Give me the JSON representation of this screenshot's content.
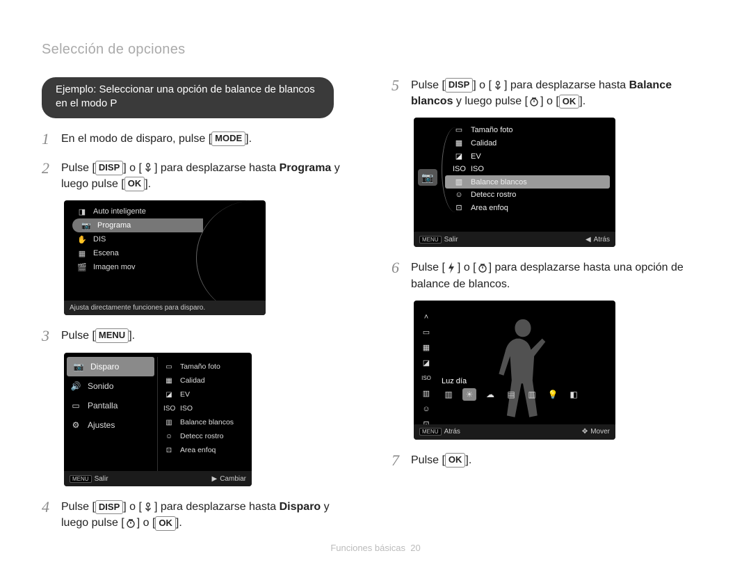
{
  "header": "Selección de opciones",
  "example_label": "Ejemplo: Seleccionar una opción de balance de blancos en el modo P",
  "icons": {
    "disp": "DISP",
    "ok": "OK",
    "menu": "MENU",
    "mode": "MODE",
    "macro": "macro-icon",
    "timer": "timer-icon",
    "flash": "flash-icon"
  },
  "steps": {
    "s1": {
      "num": "1",
      "t1": "En el modo de disparo, pulse [",
      "t2": "]."
    },
    "s2": {
      "num": "2",
      "t1": "Pulse [",
      "t2": "] o [",
      "t3": "] para desplazarse hasta ",
      "target": "Programa",
      "t4": " y luego pulse [",
      "t5": "]."
    },
    "s3": {
      "num": "3",
      "t1": "Pulse [",
      "t2": "]."
    },
    "s4": {
      "num": "4",
      "t1": "Pulse [",
      "t2": "] o [",
      "t3": "] para desplazarse hasta ",
      "target": "Disparo",
      "t4": " y luego pulse [",
      "t5": "] o [",
      "t6": "]."
    },
    "s5": {
      "num": "5",
      "t1": "Pulse [",
      "t2": "] o [",
      "t3": "] para desplazarse hasta ",
      "target": "Balance blancos",
      "t4": " y luego pulse [",
      "t5": "] o [",
      "t6": "]."
    },
    "s6": {
      "num": "6",
      "t1": "Pulse [",
      "t2": "] o [",
      "t3": "] para desplazarse hasta una opción de balance de blancos."
    },
    "s7": {
      "num": "7",
      "t1": "Pulse [",
      "t2": "]."
    }
  },
  "mode_screen": {
    "items": [
      "Auto inteligente",
      "Programa",
      "DIS",
      "Escena",
      "Imagen mov"
    ],
    "selected_index": 1,
    "help": "Ajusta directamente funciones para disparo."
  },
  "menu_screen": {
    "left": [
      "Disparo",
      "Sonido",
      "Pantalla",
      "Ajustes"
    ],
    "left_selected": 0,
    "right": [
      "Tamaño foto",
      "Calidad",
      "EV",
      "ISO",
      "Balance blancos",
      "Detecc rostro",
      "Area enfoq"
    ],
    "status_left": "Salir",
    "status_right": "Cambiar",
    "status_left_btn": "MENU"
  },
  "sub_screen": {
    "items": [
      "Tamaño foto",
      "Calidad",
      "EV",
      "ISO",
      "Balance blancos",
      "Detecc rostro",
      "Area enfoq"
    ],
    "selected_index": 4,
    "status_left": "Salir",
    "status_right": "Atrás",
    "status_left_btn": "MENU"
  },
  "wb_screen": {
    "label": "Luz día",
    "status_left": "Atrás",
    "status_right": "Mover",
    "status_left_btn": "MENU"
  },
  "footer": {
    "section": "Funciones básicas",
    "page": "20"
  }
}
